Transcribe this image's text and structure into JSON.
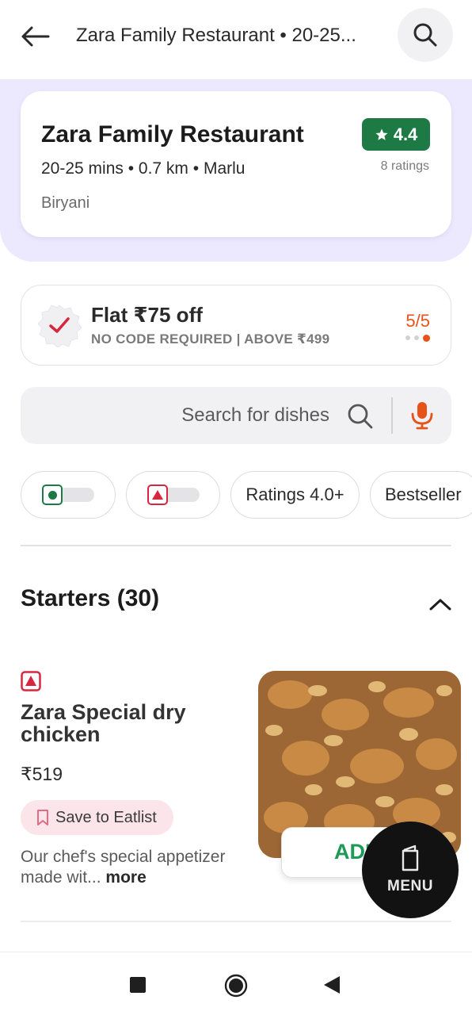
{
  "topbar": {
    "title": "Zara Family Restaurant • 20-25...",
    "back_icon": "arrow-left-icon",
    "search_icon": "search-icon"
  },
  "restaurant": {
    "name": "Zara Family Restaurant",
    "meta": "20-25 mins • 0.7 km • Marlu",
    "cuisine": "Biryani",
    "rating": "4.4",
    "rating_count": "8 ratings",
    "rating_color": "#1d7a45"
  },
  "offer": {
    "title": "Flat ₹75 off",
    "subtitle": "NO CODE REQUIRED | ABOVE ₹499",
    "counter": "5/5",
    "accent": "#e5531a"
  },
  "search": {
    "placeholder": "Search for dishes",
    "mic_icon": "mic-icon"
  },
  "filters": {
    "veg_toggle": "veg-toggle",
    "nonveg_toggle": "nonveg-toggle",
    "ratings": "Ratings 4.0+",
    "bestseller": "Bestseller"
  },
  "section": {
    "title": "Starters (30)"
  },
  "dish": {
    "name": "Zara Special dry chicken",
    "price": "₹519",
    "save_label": "Save to Eatlist",
    "description": "Our chef's special appetizer made wit...",
    "more_label": "more",
    "add_label": "ADD"
  },
  "menu_fab": {
    "label": "MENU"
  },
  "colors": {
    "brand_green": "#1e9a58",
    "lavender": "#ece9fe",
    "nonveg_red": "#d7263d"
  }
}
